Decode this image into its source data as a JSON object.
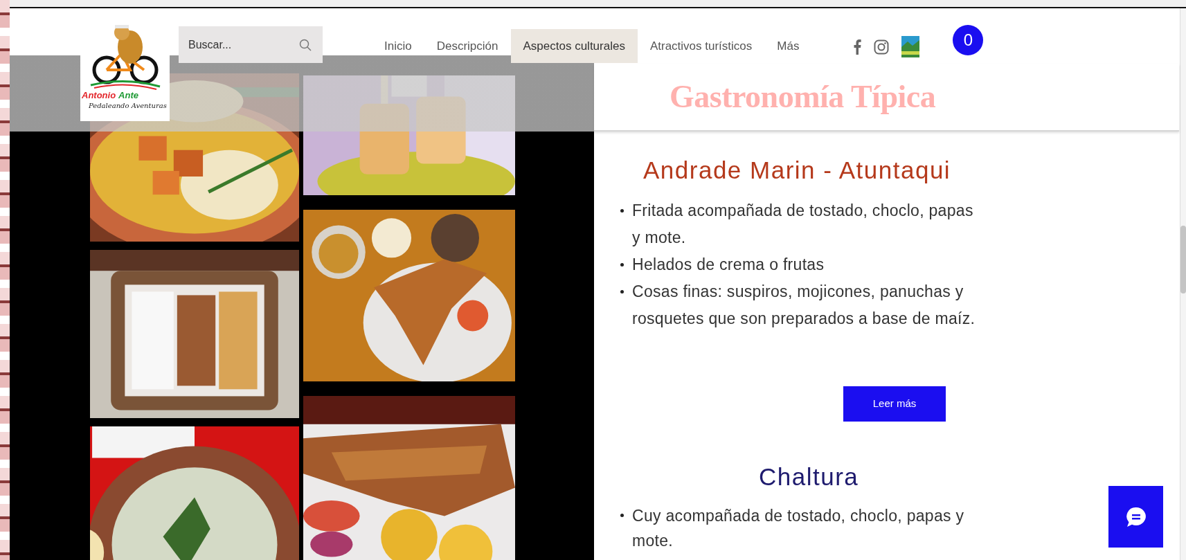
{
  "header": {
    "logo": {
      "words": [
        {
          "text": "Antonio",
          "color": "#e3262b"
        },
        {
          "text": "Ante",
          "color": "#1f9a35"
        }
      ],
      "tagline": "Pedaleando Aventuras"
    },
    "search": {
      "placeholder": "Buscar..."
    },
    "nav": [
      {
        "label": "Inicio",
        "selected": false
      },
      {
        "label": "Descripción",
        "selected": false
      },
      {
        "label": "Aspectos culturales",
        "selected": true
      },
      {
        "label": "Atractivos turísticos",
        "selected": false
      },
      {
        "label": "Más",
        "selected": false
      }
    ],
    "cart": {
      "count": "0"
    }
  },
  "title": "Gastronomía Típica",
  "sections": [
    {
      "heading": "Andrade Marin - Atuntaqui",
      "color": "#b5391b",
      "items": [
        "Fritada acompañada de tostado, choclo, papas y mote.",
        "Helados de crema o frutas",
        "Cosas finas: suspiros, mojicones, panuchas y rosquetes que son preparados a base de maíz."
      ],
      "button": "Leer más"
    },
    {
      "heading": "Chaltura",
      "color": "#1e1b6e",
      "items": [
        "Cuy acompañada de tostado, choclo, papas y mote."
      ]
    }
  ]
}
